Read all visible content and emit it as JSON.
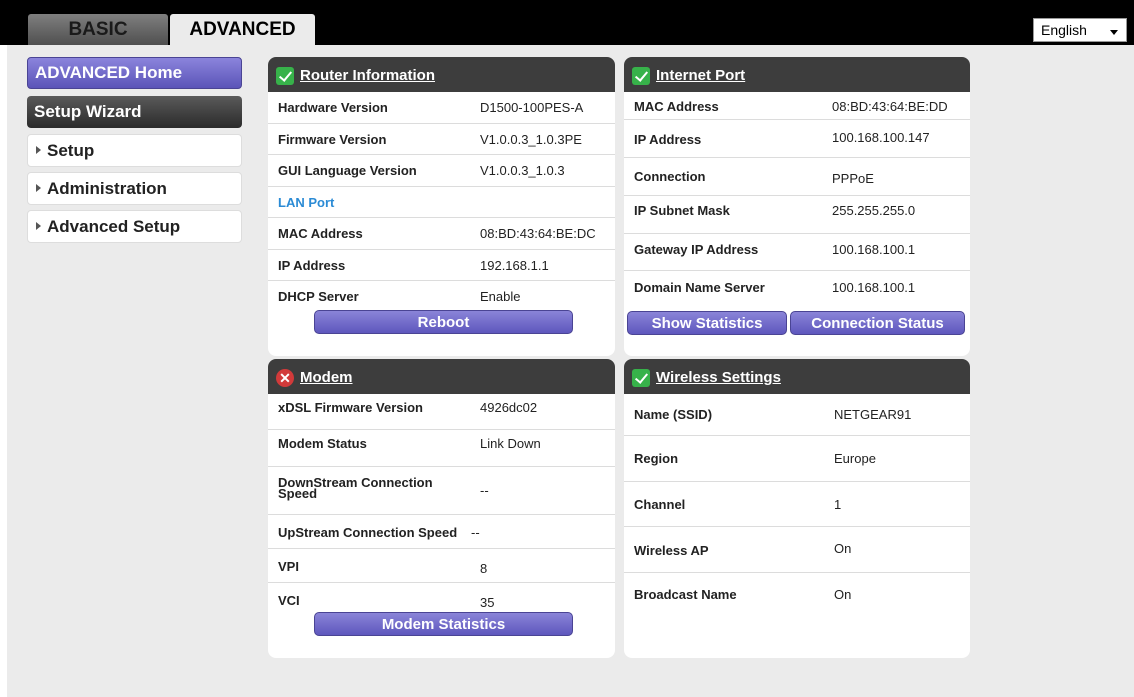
{
  "tabs": {
    "basic": "BASIC",
    "advanced": "ADVANCED"
  },
  "language": {
    "selected": "English"
  },
  "sidebar": {
    "home": "ADVANCED Home",
    "wizard": "Setup Wizard",
    "setup": "Setup",
    "administration": "Administration",
    "advanced_setup": "Advanced Setup"
  },
  "router": {
    "title": "Router Information",
    "rows": [
      {
        "label": "Hardware Version",
        "value": "D1500-100PES-A"
      },
      {
        "label": "Firmware Version",
        "value": "V1.0.0.3_1.0.3PE"
      },
      {
        "label": "GUI Language Version",
        "value": "V1.0.0.3_1.0.3"
      },
      {
        "label": "LAN Port",
        "value": ""
      },
      {
        "label": "MAC Address",
        "value": "08:BD:43:64:BE:DC"
      },
      {
        "label": "IP Address",
        "value": "192.168.1.1"
      },
      {
        "label": "DHCP Server",
        "value": "Enable"
      }
    ],
    "button": "Reboot"
  },
  "internet": {
    "title": "Internet Port",
    "rows": [
      {
        "label": "MAC Address",
        "value": "08:BD:43:64:BE:DD"
      },
      {
        "label": "IP Address",
        "value": "100.168.100.147"
      },
      {
        "label": "Connection",
        "value": "PPPoE"
      },
      {
        "label": "IP Subnet Mask",
        "value": "255.255.255.0"
      },
      {
        "label": "Gateway IP Address",
        "value": "100.168.100.1"
      },
      {
        "label": "Domain Name Server",
        "value": "100.168.100.1"
      }
    ],
    "button_stats": "Show Statistics",
    "button_conn": "Connection Status"
  },
  "modem": {
    "title": "Modem",
    "rows": [
      {
        "label": "xDSL Firmware Version",
        "value": "4926dc02"
      },
      {
        "label": "Modem Status",
        "value": "Link Down"
      },
      {
        "label": "DownStream Connection Speed",
        "value": "--"
      },
      {
        "label": "UpStream Connection Speed",
        "value": "--"
      },
      {
        "label": "VPI",
        "value": "8"
      },
      {
        "label": "VCI",
        "value": "35"
      }
    ],
    "button": "Modem Statistics"
  },
  "wireless": {
    "title": "Wireless Settings",
    "rows": [
      {
        "label": "Name (SSID)",
        "value": "NETGEAR91"
      },
      {
        "label": "Region",
        "value": "Europe"
      },
      {
        "label": "Channel",
        "value": "1"
      },
      {
        "label": "Wireless AP",
        "value": "On"
      },
      {
        "label": "Broadcast Name",
        "value": "On"
      }
    ]
  },
  "colors": {
    "accent": "#5e57bd",
    "header": "#3d3d3d",
    "ok": "#37b24a",
    "error": "#d23a3a",
    "section": "#2b8bd5"
  }
}
